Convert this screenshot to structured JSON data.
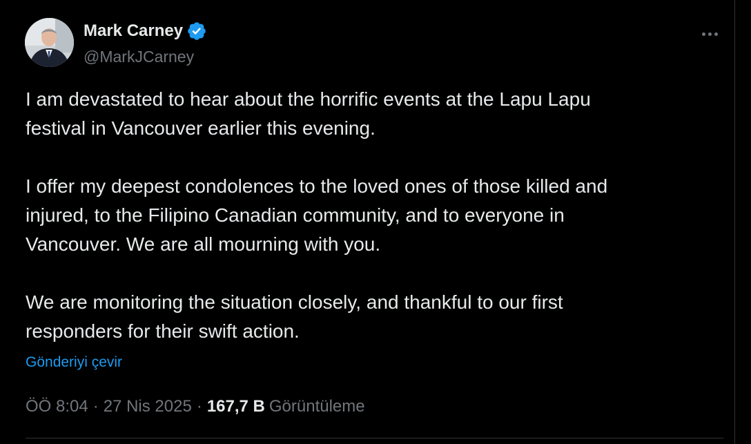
{
  "author": {
    "display_name": "Mark Carney",
    "handle": "@MarkJCarney",
    "verified_icon": "verified-badge-icon",
    "verified_color": "#1d9bf0"
  },
  "tweet": {
    "paragraphs": [
      "I am devastated to hear about the horrific events at the Lapu Lapu\nfestival in Vancouver earlier this evening.",
      "I offer my deepest condolences to the loved ones of those killed and\ninjured, to the Filipino Canadian community, and to everyone in\nVancouver. We are all mourning with you.",
      "We are monitoring the situation closely, and thankful to our first\nresponders for their swift action."
    ],
    "translate_label": "Gönderiyi çevir"
  },
  "meta": {
    "time": "ÖÖ 8:04",
    "separator": "·",
    "date": "27 Nis 2025",
    "views_count": "167,7 B",
    "views_label": "Görüntüleme"
  },
  "icons": {
    "more": "more-horizontal-icon"
  },
  "colors": {
    "background": "#000000",
    "text": "#e7e9ea",
    "secondary": "#71767b",
    "accent": "#1d9bf0",
    "border": "#2f3336"
  }
}
